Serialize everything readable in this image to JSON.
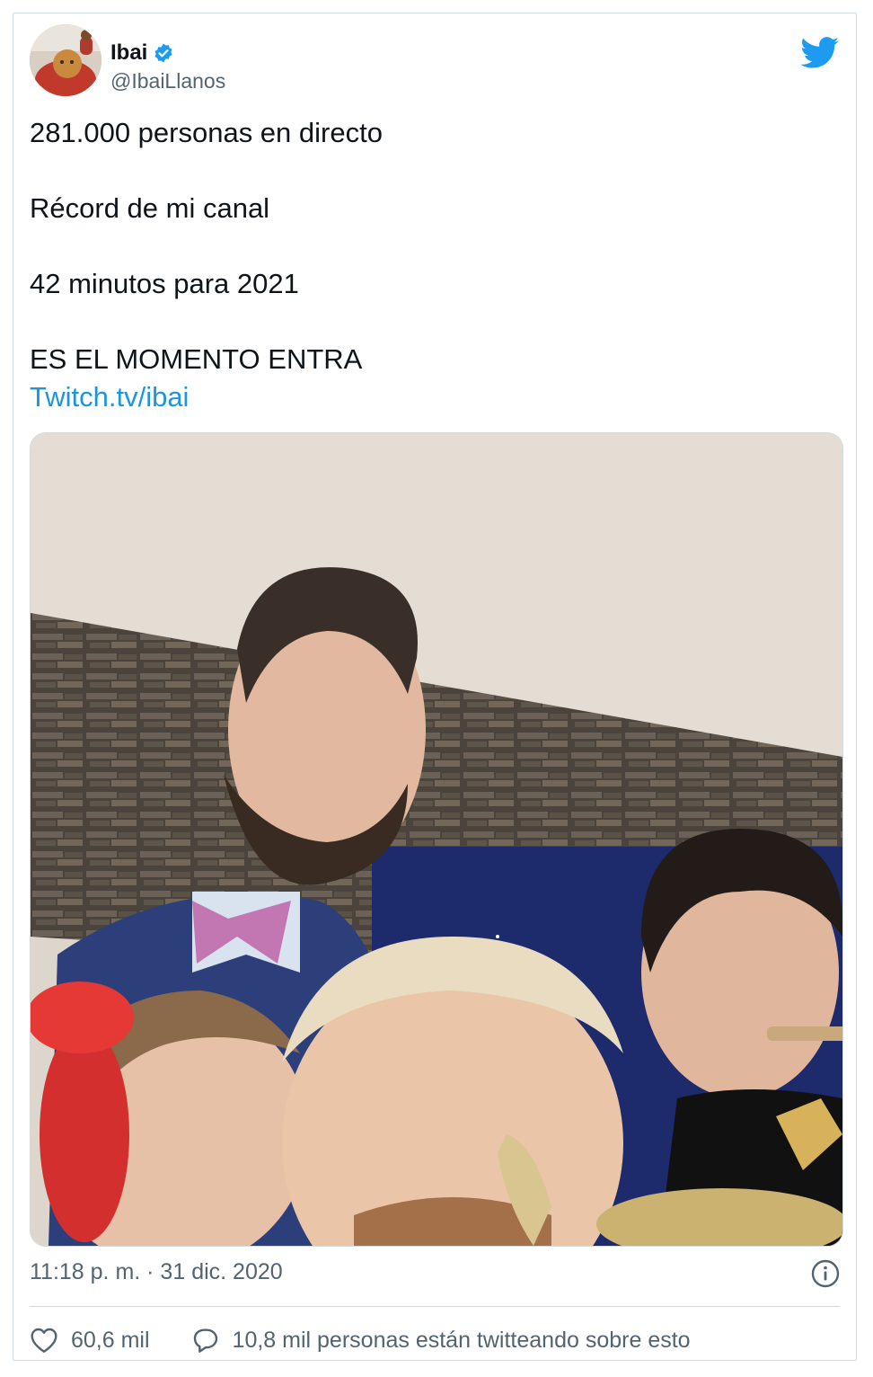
{
  "tweet": {
    "author": {
      "display_name": "Ibai",
      "handle": "@IbaiLlanos",
      "verified": true,
      "avatar_icon": "avatar-photo"
    },
    "platform_icon": "twitter-bird-icon",
    "text_lines": [
      "281.000 personas en directo",
      "Récord de mi canal",
      "42 minutos para 2021",
      "ES EL MOMENTO ENTRA"
    ],
    "link_text": "Twitch.tv/ibai",
    "timestamp": "11:18 p. m. · 31 dic. 2020",
    "likes_count": "60,6 mil",
    "conversation_text": "10,8 mil personas están twitteando sobre esto"
  },
  "colors": {
    "link": "#1b95e0",
    "verified_badge": "#1d9bf0",
    "twitter_blue": "#1d9bf0",
    "muted_text": "#536471",
    "border": "#cfd9de"
  }
}
